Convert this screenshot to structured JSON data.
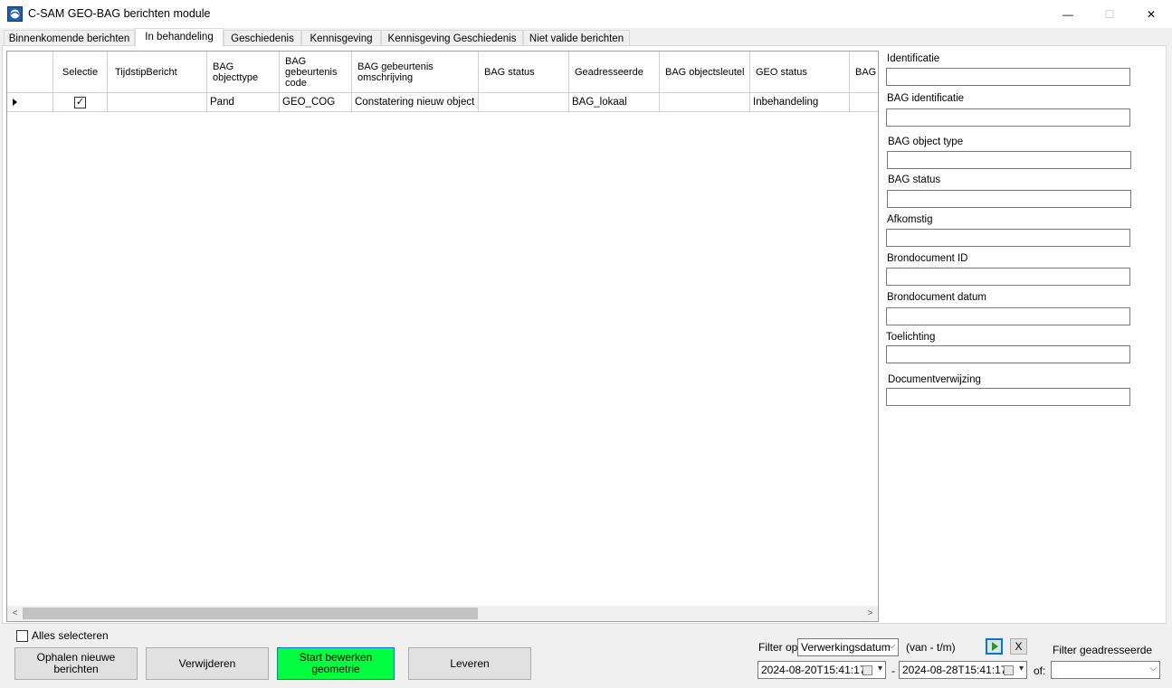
{
  "window": {
    "title": "C-SAM GEO-BAG berichten module",
    "min_glyph": "—",
    "max_glyph": "☐",
    "close_glyph": "✕"
  },
  "tabs": [
    {
      "label": "Binnenkomende berichten"
    },
    {
      "label": "In behandeling",
      "active": true
    },
    {
      "label": "Geschiedenis"
    },
    {
      "label": "Kennisgeving"
    },
    {
      "label": "Kennisgeving Geschiedenis"
    },
    {
      "label": "Niet valide berichten"
    }
  ],
  "grid": {
    "columns": [
      "",
      "Selectie",
      "TijdstipBericht",
      "BAG objecttype",
      "BAG gebeurtenis code",
      "BAG gebeurtenis omschrijving",
      "BAG status",
      "Geadresseerde",
      "BAG objectsleutel",
      "GEO status",
      "BAG"
    ],
    "rows": [
      {
        "selected": "✓",
        "tijdstip": "",
        "objecttype": "Pand",
        "code": "GEO_COG",
        "omschrijving": "Constatering nieuw object",
        "status": "",
        "geadresseerde": "BAG_lokaal",
        "objectsleutel": "",
        "geo_status": "Inbehandeling",
        "extra": ""
      }
    ],
    "scroll_left": "<",
    "scroll_right": ">"
  },
  "details": {
    "fields": [
      {
        "label": "Identificatie",
        "value": ""
      },
      {
        "label": "BAG identificatie",
        "value": ""
      },
      {
        "label": "BAG object type",
        "value": ""
      },
      {
        "label": "BAG status",
        "value": ""
      },
      {
        "label": "Afkomstig",
        "value": ""
      },
      {
        "label": "Brondocument ID",
        "value": ""
      },
      {
        "label": "Brondocument datum",
        "value": ""
      },
      {
        "label": "Toelichting",
        "value": ""
      },
      {
        "label": "Documentverwijzing",
        "value": ""
      }
    ]
  },
  "bottom": {
    "select_all_label": "Alles selecteren",
    "buttons": {
      "fetch": "Ophalen nieuwe berichten",
      "delete": "Verwijderen",
      "start": "Start bewerken geometrie",
      "deliver": "Leveren"
    },
    "filter_on_label": "Filter op",
    "filter_on_value": "Verwerkingsdatum",
    "range_label": "(van - t/m)",
    "date_from": "2024-08-20T15:41:17",
    "date_to": "2024-08-28T15:41:17",
    "dash": "-",
    "or_label": "of:",
    "filter_addressee_label": "Filter geadresseerde",
    "filter_addressee_value": "",
    "clear_label": "X"
  },
  "colors": {
    "start_button": "#00ff40",
    "focus_border": "#0078d7"
  }
}
